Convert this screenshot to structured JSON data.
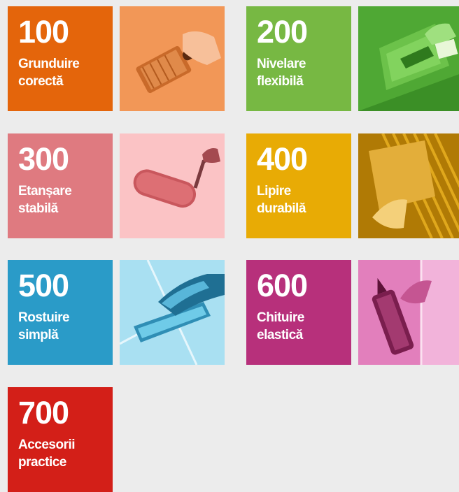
{
  "categories": [
    {
      "number": "100",
      "line1": "Grunduire",
      "line2": "corectă",
      "color": "#e4650b",
      "photo_color": "#f0904c",
      "icon": "brush-priming-photo"
    },
    {
      "number": "200",
      "line1": "Nivelare",
      "line2": "flexibilă",
      "color": "#77b843",
      "photo_color": "#5ab33a",
      "icon": "trowel-levelling-photo"
    },
    {
      "number": "300",
      "line1": "Etanșare",
      "line2": "stabilă",
      "color": "#df7a80",
      "photo_color": "#f3a3a6",
      "icon": "paint-roller-photo"
    },
    {
      "number": "400",
      "line1": "Lipire",
      "line2": "durabilă",
      "color": "#e8ab05",
      "photo_color": "#d3970a",
      "icon": "notched-trowel-photo"
    },
    {
      "number": "500",
      "line1": "Rostuire",
      "line2": "simplă",
      "color": "#2a9bc8",
      "photo_color": "#6fcbe8",
      "icon": "grout-float-photo"
    },
    {
      "number": "600",
      "line1": "Chituire",
      "line2": "elastică",
      "color": "#b7307b",
      "photo_color": "#e07bb8",
      "icon": "caulk-gun-photo"
    },
    {
      "number": "700",
      "line1": "Accesorii",
      "line2": "practice",
      "color": "#d31f18",
      "icon": "none"
    }
  ]
}
